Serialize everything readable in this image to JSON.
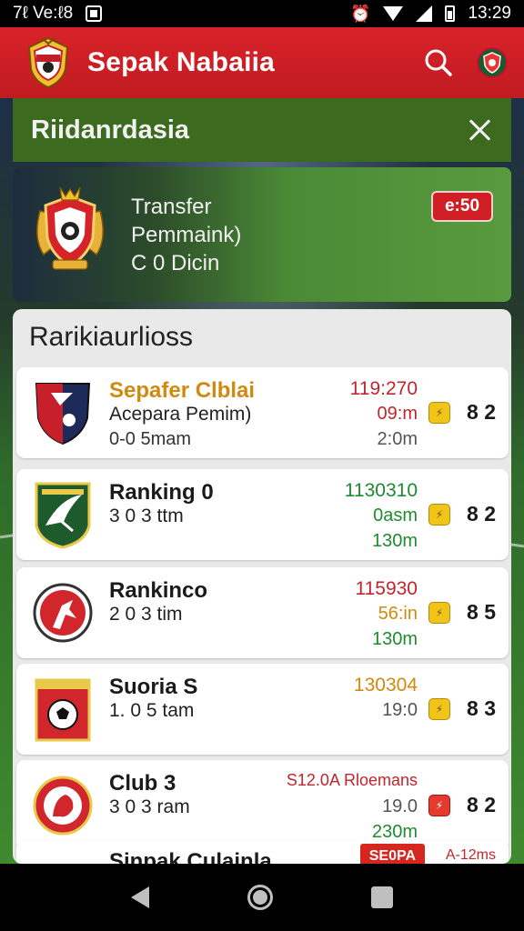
{
  "status_bar": {
    "left_text": "7ℓ Ve:ℓ8",
    "time": "13:29"
  },
  "app_bar": {
    "title": "Sepak Nabaiia",
    "icons": [
      "app-logo-crest",
      "search-icon",
      "profile-avatar"
    ]
  },
  "banner": {
    "title": "Riidanrdasia",
    "close_icon": "close-icon"
  },
  "featured": {
    "line1": "Transfer",
    "line2": "Pemmaink)",
    "line3": "C 0 Dicin",
    "badge": "e:50",
    "badge_color": "#cf1e24"
  },
  "rankings": {
    "heading": "Rarikiaurlioss",
    "rows": [
      {
        "name": "Sepafer Clblai",
        "name_color": "#d18a0f",
        "sub": "Acepara Pemim)",
        "sub2": "0-0 5mam",
        "stat1": "119:270",
        "stat1_color": "#c0262c",
        "stat2": "09:m",
        "stat2_color": "#c0262c",
        "stat3": "2:0m",
        "stat3_color": "#555555",
        "coin": "yellow",
        "points": "8 2",
        "crest": "navy-red-shield"
      },
      {
        "name": "Ranking 0",
        "name_color": "#1a1a1a",
        "sub": "3 0 3 ttm",
        "sub2": "",
        "stat1": "1130310",
        "stat1_color": "#1f8a2f",
        "stat2": "0asm",
        "stat2_color": "#1f8a2f",
        "stat3": "130m",
        "stat3_color": "#1f8a2f",
        "coin": "yellow",
        "points": "8 2",
        "crest": "green-bird-shield"
      },
      {
        "name": "Rankinco",
        "name_color": "#1a1a1a",
        "sub": "2 0 3 tim",
        "sub2": "",
        "stat1": "115930",
        "stat1_color": "#c0262c",
        "stat2": "56:in",
        "stat2_color": "#d18a0f",
        "stat3": "130m",
        "stat3_color": "#1f8a2f",
        "coin": "yellow",
        "points": "8 5",
        "crest": "red-player-round"
      },
      {
        "name": "Suoria S",
        "name_color": "#1a1a1a",
        "sub": "1. 0 5 tam",
        "sub2": "",
        "stat1": "130304",
        "stat1_color": "#d18a0f",
        "stat2": "19:0",
        "stat2_color": "#555555",
        "stat3": "",
        "stat3_color": "#555555",
        "coin": "yellow",
        "points": "8 3",
        "crest": "red-ball-square"
      },
      {
        "name": "Club 3",
        "name_color": "#1a1a1a",
        "sub": "3 0 3 ram",
        "sub2": "",
        "stat1": "S12.0A Rloemans",
        "stat1_color": "#c0262c",
        "stat2": "19.0",
        "stat2_color": "#555555",
        "stat3": "230m",
        "stat3_color": "#1f8a2f",
        "coin": "red",
        "points": "8 2",
        "crest": "red-lion-round"
      }
    ],
    "partial_row": {
      "name": "Sinpak Culainla",
      "tag": "SE0PA",
      "right": "A-12ms"
    }
  },
  "nav": {
    "back": "back-icon",
    "home": "home-icon",
    "recent": "recent-apps-icon"
  }
}
